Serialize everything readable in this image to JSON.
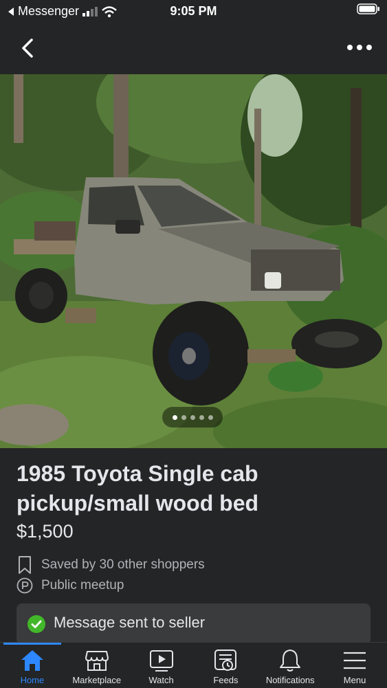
{
  "status_bar": {
    "back_app": "Messenger",
    "time": "9:05 PM"
  },
  "listing": {
    "title": "1985 Toyota Single cab pickup/small wood bed",
    "price": "$1,500",
    "saved_text": "Saved by 30 other shoppers",
    "meetup_text": "Public meetup",
    "photo_count": 5,
    "active_photo_index": 0
  },
  "toast": {
    "text": "Message sent to seller",
    "color": "#42b72a"
  },
  "tabs": [
    {
      "label": "Home",
      "icon": "home-icon",
      "active": true
    },
    {
      "label": "Marketplace",
      "icon": "marketplace-icon",
      "active": false
    },
    {
      "label": "Watch",
      "icon": "watch-icon",
      "active": false
    },
    {
      "label": "Feeds",
      "icon": "feeds-icon",
      "active": false
    },
    {
      "label": "Notifications",
      "icon": "bell-icon",
      "active": false
    },
    {
      "label": "Menu",
      "icon": "menu-icon",
      "active": false
    }
  ],
  "colors": {
    "accent": "#2d88ff",
    "background": "#242526"
  }
}
